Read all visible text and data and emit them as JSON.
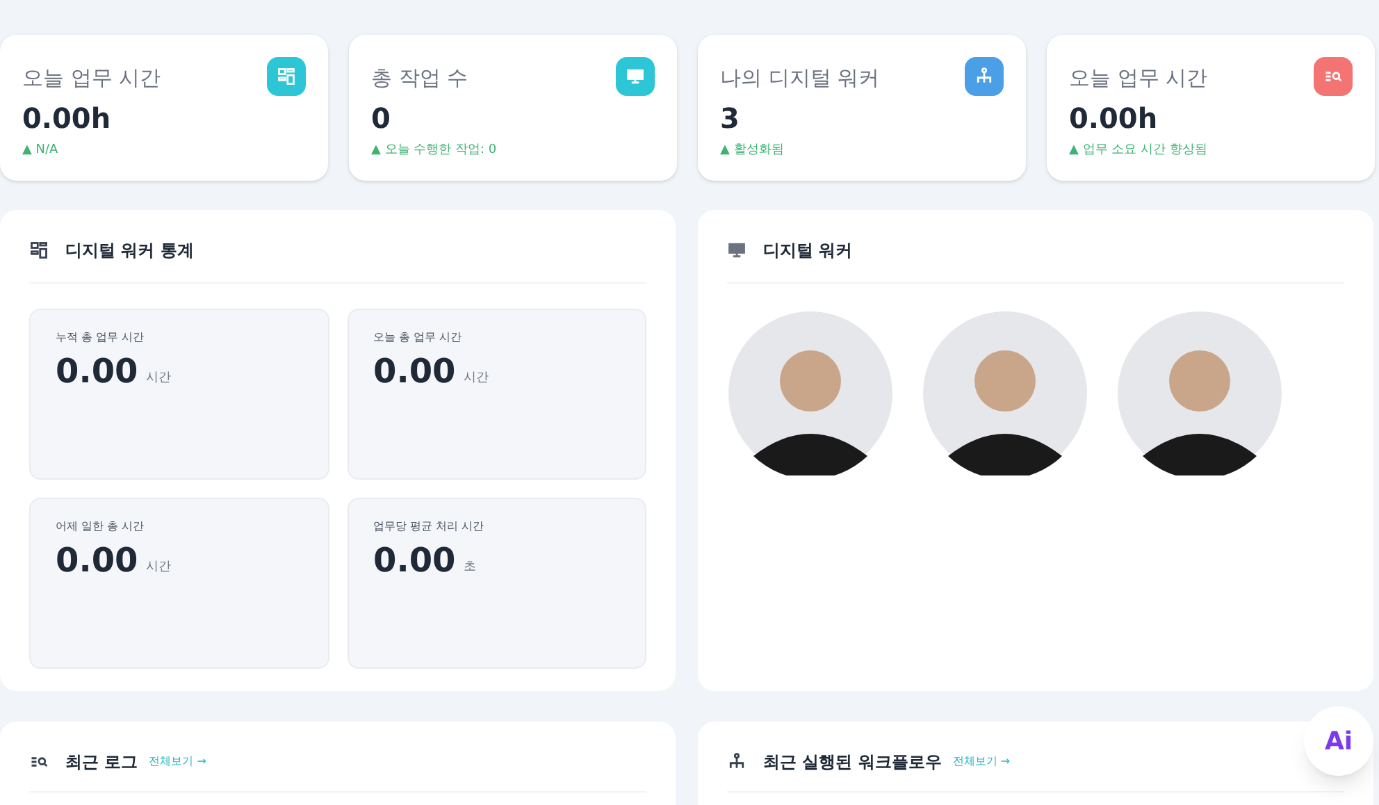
{
  "summary_cards": [
    {
      "title": "오늘 업무 시간",
      "value": "0.00h",
      "trend": "▲ N/A",
      "kind": "grid",
      "color": "#2cc6d6"
    },
    {
      "title": "총 작업 수",
      "value": "0",
      "trend": "▲ 오늘 수행한 작업: 0",
      "kind": "monitor",
      "color": "#2cc6d6"
    },
    {
      "title": "나의 디지털 워커",
      "value": "3",
      "trend": "▲ 활성화됨",
      "kind": "tree",
      "color": "#4a9fe6"
    },
    {
      "title": "오늘 업무 시간",
      "value": "0.00h",
      "trend": "▲ 업무 소요 시간 향상됨",
      "kind": "search",
      "color": "#f47373"
    }
  ],
  "stats_panel": {
    "title": "디지털 워커 통계",
    "items": [
      {
        "label": "누적 총 업무 시간",
        "value": "0.00",
        "unit": "시간"
      },
      {
        "label": "오늘 총 업무 시간",
        "value": "0.00",
        "unit": "시간"
      },
      {
        "label": "어제 일한 총 시간",
        "value": "0.00",
        "unit": "시간"
      },
      {
        "label": "업무당 평균 처리 시간",
        "value": "0.00",
        "unit": "초"
      }
    ]
  },
  "workers_panel": {
    "title": "디지털 워커",
    "workers": [
      {
        "kind": "avatar"
      },
      {
        "kind": "avatar"
      },
      {
        "kind": "avatar"
      }
    ]
  },
  "bottom_panels": [
    {
      "title": "최근 로그",
      "link": "전체보기 →",
      "kind": "search"
    },
    {
      "title": "최근 실행된 워크플로우",
      "link": "전체보기 →",
      "kind": "tree"
    }
  ],
  "ai_button": {
    "label": "Ai"
  }
}
